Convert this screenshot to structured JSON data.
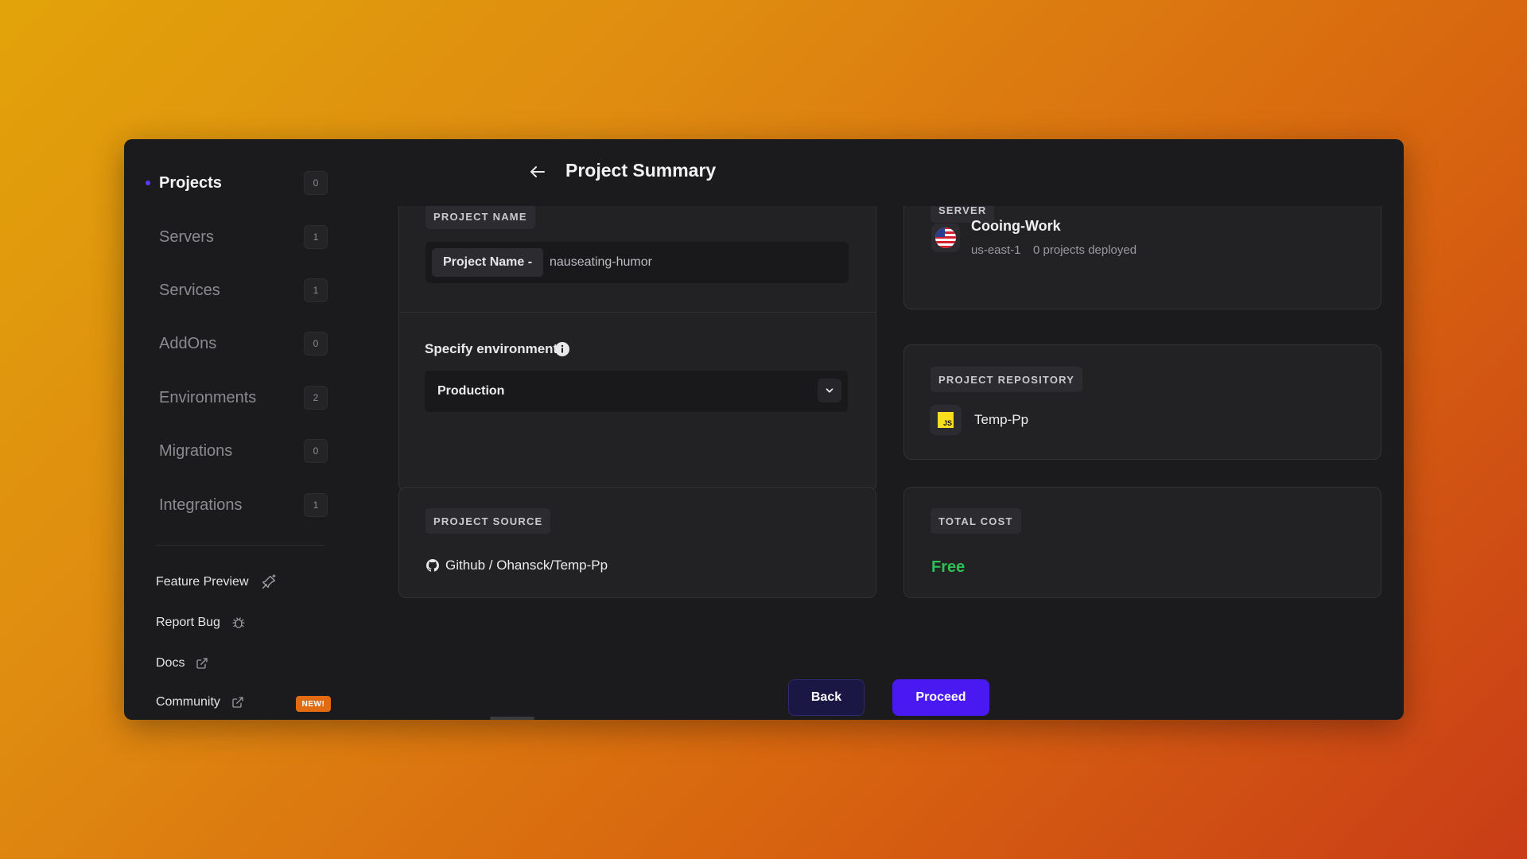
{
  "sidebar": {
    "items": [
      {
        "label": "Projects",
        "count": "0",
        "active": true
      },
      {
        "label": "Servers",
        "count": "1"
      },
      {
        "label": "Services",
        "count": "1"
      },
      {
        "label": "AddOns",
        "count": "0"
      },
      {
        "label": "Environments",
        "count": "2"
      },
      {
        "label": "Migrations",
        "count": "0"
      },
      {
        "label": "Integrations",
        "count": "1"
      }
    ],
    "utilities": [
      {
        "label": "Feature Preview",
        "icon": "sparkle-pin-icon"
      },
      {
        "label": "Report Bug",
        "icon": "bug-icon"
      },
      {
        "label": "Docs",
        "icon": "external-link-icon"
      },
      {
        "label": "Community",
        "icon": "external-link-icon"
      }
    ],
    "new_badge": "NEW!"
  },
  "header": {
    "title": "Project Summary"
  },
  "project_name": {
    "tag": "PROJECT NAME",
    "prefix": "Project Name -",
    "value": "nauseating-humor"
  },
  "environment": {
    "label": "Specify environment",
    "selected": "Production"
  },
  "server": {
    "tag": "SERVER",
    "name": "Cooing-Work",
    "region": "us-east-1",
    "deployed": "0 projects deployed"
  },
  "repository": {
    "tag": "PROJECT REPOSITORY",
    "name": "Temp-Pp",
    "icon_text": "JS"
  },
  "source": {
    "tag": "PROJECT SOURCE",
    "value": "Github / Ohansck/Temp-Pp"
  },
  "cost": {
    "tag": "TOTAL COST",
    "value": "Free"
  },
  "actions": {
    "back": "Back",
    "proceed": "Proceed"
  },
  "colors": {
    "accent": "#4a18f0",
    "success": "#2fbf57",
    "badge": "#e06b12"
  }
}
